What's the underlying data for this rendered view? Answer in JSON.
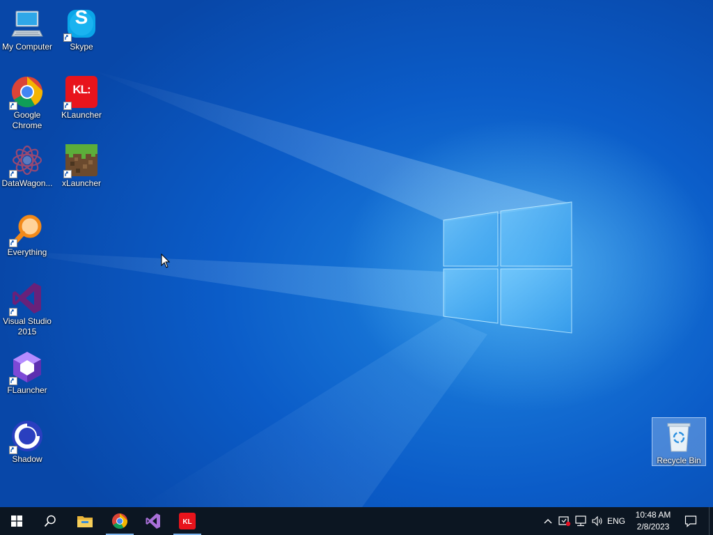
{
  "desktop": {
    "icons": [
      {
        "label": "My Computer",
        "icon": "computer-icon",
        "shortcut": false
      },
      {
        "label": "Skype",
        "icon": "skype-icon",
        "shortcut": true
      },
      {
        "label": "Google Chrome",
        "icon": "chrome-icon",
        "shortcut": true
      },
      {
        "label": "KLauncher",
        "icon": "klauncher-icon",
        "shortcut": true
      },
      {
        "label": "DataWagon...",
        "icon": "datawagon-icon",
        "shortcut": true
      },
      {
        "label": "xLauncher",
        "icon": "xlauncher-icon",
        "shortcut": true
      },
      {
        "label": "Everything",
        "icon": "everything-icon",
        "shortcut": true
      },
      {
        "label": "Visual Studio 2015",
        "icon": "visual-studio-icon",
        "shortcut": true
      },
      {
        "label": "FLauncher",
        "icon": "flauncher-icon",
        "shortcut": true
      },
      {
        "label": "Shadow",
        "icon": "shadow-icon",
        "shortcut": true
      },
      {
        "label": "Recycle Bin",
        "icon": "recycle-bin-icon",
        "shortcut": false
      }
    ],
    "skype_glyph": "S",
    "klauncher_glyph": "KL:"
  },
  "taskbar": {
    "pinned": [
      {
        "name": "start",
        "icon": "windows-start-icon",
        "running": false
      },
      {
        "name": "search",
        "icon": "search-icon",
        "running": false
      },
      {
        "name": "file-explorer",
        "icon": "folder-icon",
        "running": false
      },
      {
        "name": "chrome",
        "icon": "chrome-icon",
        "running": true
      },
      {
        "name": "visual-studio",
        "icon": "visual-studio-icon",
        "running": false
      },
      {
        "name": "klauncher",
        "icon": "klauncher-icon",
        "running": true
      }
    ],
    "tray": {
      "language": "ENG",
      "time": "10:48 AM",
      "date": "2/8/2023",
      "icons": [
        "chevron-up-icon",
        "security-icon",
        "network-icon",
        "volume-icon",
        "notification-icon"
      ]
    }
  },
  "colors": {
    "accent": "#0b5cc8",
    "taskbar": "#0c1622",
    "klauncher_red": "#e8141c",
    "vs_purple": "#68217a"
  }
}
